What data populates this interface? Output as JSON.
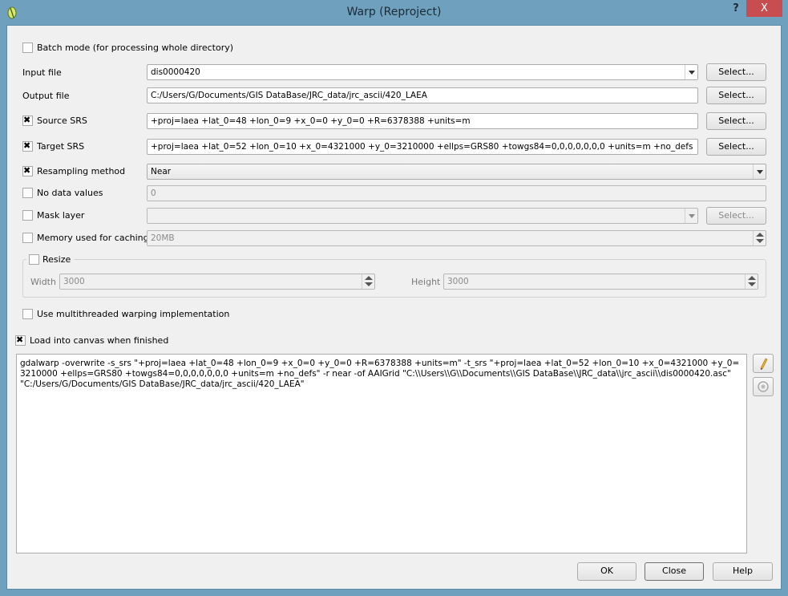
{
  "window": {
    "title": "Warp (Reproject)",
    "help_label": "?",
    "close_label": "X"
  },
  "batch_mode": {
    "label": "Batch mode (for processing whole directory)",
    "checked": false
  },
  "input_file": {
    "label": "Input file",
    "value": "dis0000420",
    "select_label": "Select..."
  },
  "output_file": {
    "label": "Output file",
    "value": "C:/Users/G/Documents/GIS DataBase/JRC_data/jrc_ascii/420_LAEA",
    "select_label": "Select..."
  },
  "source_srs": {
    "label": "Source SRS",
    "checked": true,
    "value": "+proj=laea +lat_0=48 +lon_0=9 +x_0=0 +y_0=0 +R=6378388 +units=m",
    "select_label": "Select..."
  },
  "target_srs": {
    "label": "Target SRS",
    "checked": true,
    "value": "+proj=laea +lat_0=52 +lon_0=10 +x_0=4321000 +y_0=3210000 +ellps=GRS80 +towgs84=0,0,0,0,0,0,0 +units=m +no_defs",
    "select_label": "Select..."
  },
  "resampling": {
    "label": "Resampling method",
    "checked": true,
    "value": "Near"
  },
  "no_data": {
    "label": "No data values",
    "checked": false,
    "value": "0"
  },
  "mask_layer": {
    "label": "Mask layer",
    "checked": false,
    "value": "",
    "select_label": "Select..."
  },
  "memory": {
    "label": "Memory used for caching",
    "checked": false,
    "value": "20MB"
  },
  "resize": {
    "label": "Resize",
    "checked": false,
    "width_label": "Width",
    "width_value": "3000",
    "height_label": "Height",
    "height_value": "3000"
  },
  "multithread": {
    "label": "Use multithreaded warping implementation",
    "checked": false
  },
  "load_canvas": {
    "label": "Load into canvas when finished",
    "checked": true
  },
  "command": "gdalwarp -overwrite -s_srs \"+proj=laea +lat_0=48 +lon_0=9 +x_0=0 +y_0=0 +R=6378388 +units=m\" -t_srs \"+proj=laea +lat_0=52 +lon_0=10 +x_0=4321000 +y_0=3210000 +ellps=GRS80 +towgs84=0,0,0,0,0,0,0 +units=m +no_defs\" -r near -of AAIGrid \"C:\\\\Users\\\\G\\\\Documents\\\\GIS DataBase\\\\JRC_data\\\\jrc_ascii\\\\dis0000420.asc\" \"C:/Users/G/Documents/GIS DataBase/JRC_data/jrc_ascii/420_LAEA\"",
  "buttons": {
    "ok": "OK",
    "close": "Close",
    "help": "Help"
  }
}
